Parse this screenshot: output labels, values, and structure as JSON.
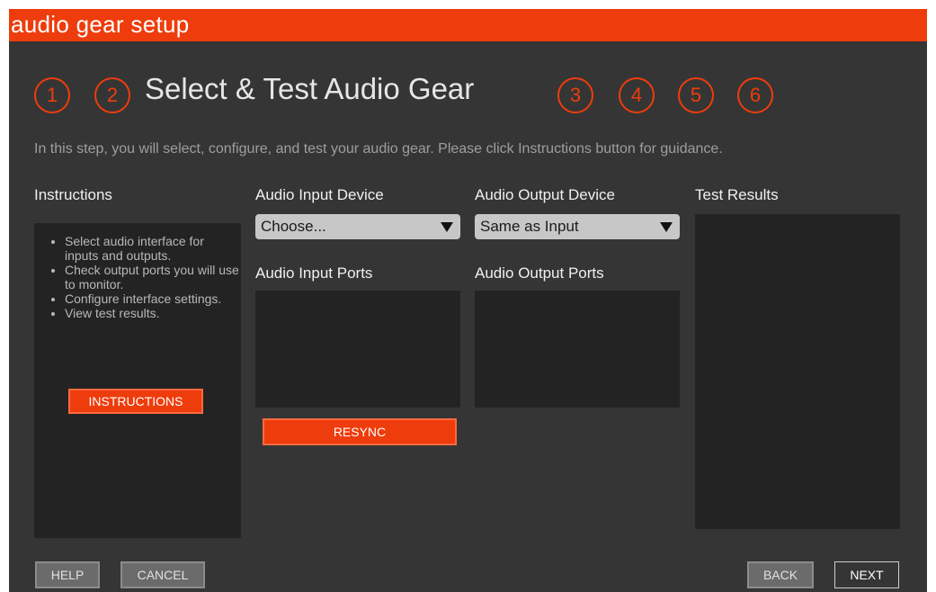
{
  "window": {
    "title": "audio gear setup"
  },
  "steps": {
    "items": [
      "1",
      "2",
      "3",
      "4",
      "5",
      "6"
    ],
    "current_title": "Select & Test Audio Gear"
  },
  "subtitle": "In this step, you will select, configure, and test your audio gear. Please click Instructions button for guidance.",
  "instructions": {
    "heading": "Instructions",
    "items": [
      "Select audio interface for inputs and outputs.",
      "Check output ports you will use to monitor.",
      "Configure interface settings.",
      "View test results."
    ],
    "button_label": "INSTRUCTIONS"
  },
  "input_device": {
    "label": "Audio Input Device",
    "selected": "Choose..."
  },
  "output_device": {
    "label": "Audio Output Device",
    "selected": "Same as Input"
  },
  "input_ports": {
    "label": "Audio Input Ports"
  },
  "output_ports": {
    "label": "Audio Output Ports"
  },
  "resync_button": "RESYNC",
  "test_results": {
    "heading": "Test Results"
  },
  "footer": {
    "help": "HELP",
    "cancel": "CANCEL",
    "back": "BACK",
    "next": "NEXT"
  },
  "colors": {
    "accent": "#ee3c0c",
    "background": "#353535",
    "panel": "#232323"
  }
}
